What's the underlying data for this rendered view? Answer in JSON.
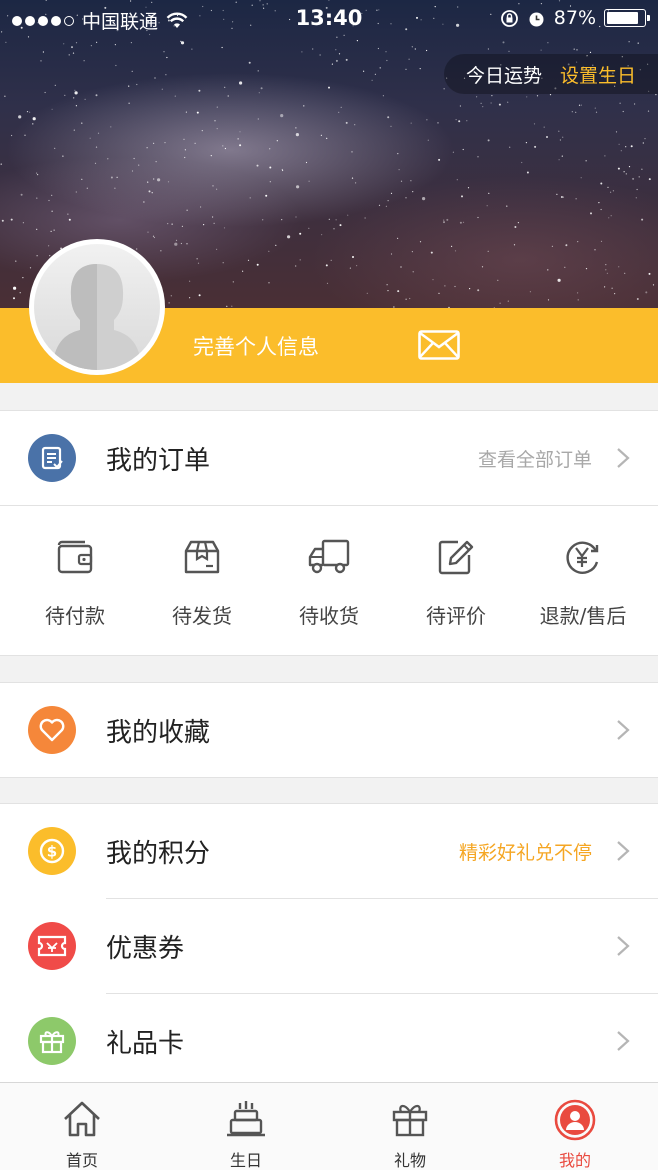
{
  "status_bar": {
    "carrier": "中国联通",
    "time": "13:40",
    "battery": "87%",
    "battery_level": 0.87,
    "icons": [
      "signal-dots",
      "wifi-icon",
      "rotation-lock-icon",
      "alarm-icon",
      "battery-icon"
    ]
  },
  "header": {
    "fortune_label": "今日运势",
    "set_birthday_label": "设置生日",
    "complete_info_label": "完善个人信息",
    "avatar": "default-avatar",
    "message_icon": "envelope-icon",
    "accent_color": "#fbbd2b"
  },
  "orders": {
    "title": "我的订单",
    "view_all": "查看全部订单",
    "icon": "order-list-icon",
    "icon_color": "#4a72a8",
    "statuses": [
      {
        "label": "待付款",
        "icon": "wallet-icon"
      },
      {
        "label": "待发货",
        "icon": "package-icon"
      },
      {
        "label": "待收货",
        "icon": "truck-icon"
      },
      {
        "label": "待评价",
        "icon": "edit-review-icon"
      },
      {
        "label": "退款/售后",
        "icon": "refund-icon"
      }
    ]
  },
  "favorites": {
    "title": "我的收藏",
    "icon": "heart-icon",
    "icon_color": "#f5873a"
  },
  "points": {
    "title": "我的积分",
    "hint": "精彩好礼兑不停",
    "hint_color": "#f5a623",
    "icon": "coin-icon",
    "icon_color": "#fbbd2b"
  },
  "coupons": {
    "title": "优惠券",
    "icon": "ticket-icon",
    "icon_color": "#f04b48"
  },
  "giftcard": {
    "title": "礼品卡",
    "icon": "gift-icon",
    "icon_color": "#8dc96a"
  },
  "tabbar": {
    "active_color": "#e94a3f",
    "tabs": [
      {
        "label": "首页",
        "icon": "home-icon"
      },
      {
        "label": "生日",
        "icon": "cake-icon"
      },
      {
        "label": "礼物",
        "icon": "gift-icon"
      },
      {
        "label": "我的",
        "icon": "profile-icon",
        "active": true
      }
    ]
  }
}
